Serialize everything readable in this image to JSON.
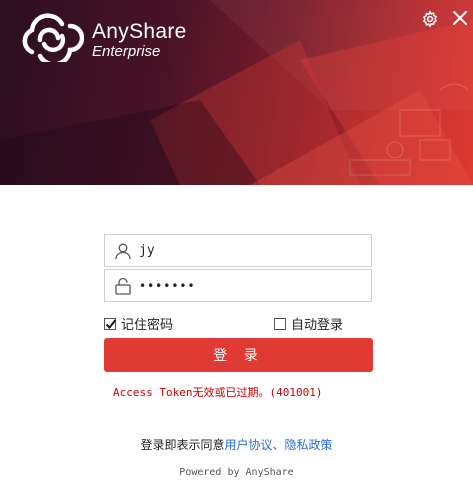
{
  "header": {
    "brand_name": "AnyShare",
    "brand_sub": "Enterprise",
    "icons": {
      "logo": "cloud-logo-icon",
      "settings": "gear-icon",
      "close": "close-icon"
    }
  },
  "form": {
    "username_value": "jy",
    "password_value": "•••••••",
    "remember_label": "记住密码",
    "remember_checked": true,
    "auto_login_label": "自动登录",
    "auto_login_checked": false,
    "login_label": "登 录",
    "icons": {
      "username": "user-icon",
      "password": "lock-icon"
    }
  },
  "error_message": "Access Token无效或已过期。(401001)",
  "agreement": {
    "prefix": "登录即表示同意",
    "user_agreement": "用户协议",
    "separator": "、",
    "privacy_policy": "隐私政策"
  },
  "footer": {
    "powered_by": "Powered by AnyShare"
  },
  "colors": {
    "primary": "#e03a35",
    "error": "#cc0000",
    "link": "#2a6dcc"
  }
}
